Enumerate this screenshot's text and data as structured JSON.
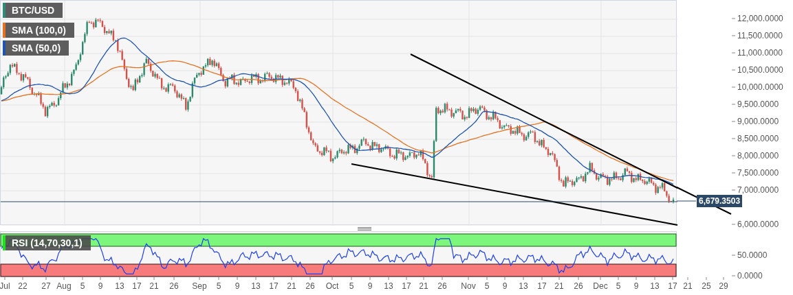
{
  "legend": [
    {
      "label": "BTC/USD",
      "color": "#2e8b77"
    },
    {
      "label": "SMA (100,0)",
      "color": "#e8711f"
    },
    {
      "label": "SMA (50,0)",
      "color": "#1e55b3"
    }
  ],
  "price_axis": [
    "12,000.0000",
    "11,500.0000",
    "11,000.0000",
    "10,500.0000",
    "10,000.0000",
    "9,500.0000",
    "9,000.0000",
    "8,500.0000",
    "8,000.0000",
    "7,500.0000",
    "7,000.0000",
    "6,000.0000"
  ],
  "last_price": "6,679.3503",
  "rsi": {
    "label": "RSI (14,70,30,1)",
    "color": "#22dd22",
    "axis": [
      "50.0000",
      "0.0000"
    ]
  },
  "date_axis": [
    "Jul",
    "22",
    "27",
    "Aug",
    "5",
    "9",
    "13",
    "17",
    "21",
    "26",
    "Sep",
    "5",
    "9",
    "13",
    "17",
    "21",
    "26",
    "Oct",
    "5",
    "9",
    "13",
    "17",
    "21",
    "26",
    "Nov",
    "5",
    "9",
    "13",
    "17",
    "21",
    "26",
    "Dec",
    "5",
    "9",
    "13",
    "17",
    "21",
    "25",
    "29"
  ]
}
